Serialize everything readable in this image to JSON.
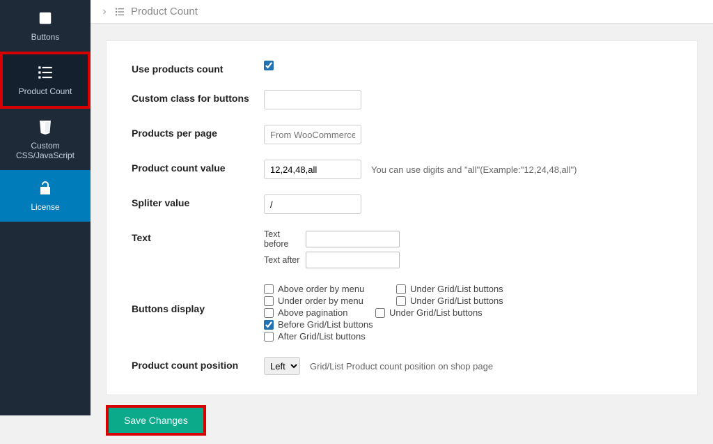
{
  "sidebar": {
    "items": [
      {
        "label": "Buttons",
        "label2": ""
      },
      {
        "label": "Product Count",
        "label2": ""
      },
      {
        "label": "Custom",
        "label2": "CSS/JavaScript"
      },
      {
        "label": "License",
        "label2": ""
      }
    ]
  },
  "breadcrumb": {
    "title": "Product Count"
  },
  "form": {
    "use_products_count_label": "Use products count",
    "custom_class_label": "Custom class for buttons",
    "custom_class_value": "",
    "products_per_page_label": "Products per page",
    "products_per_page_placeholder": "From WooCommerce",
    "product_count_value_label": "Product count value",
    "product_count_value_value": "12,24,48,all",
    "product_count_value_help": "You can use digits and \"all\"(Example:\"12,24,48,all\")",
    "spliter_value_label": "Spliter value",
    "spliter_value_value": "/",
    "text_label": "Text",
    "text_before_label": "Text before",
    "text_before_value": "",
    "text_after_label": "Text after",
    "text_after_value": "",
    "buttons_display_label": "Buttons display",
    "buttons_display_options": {
      "above_order": "Above order by menu",
      "under_order": "Under order by menu",
      "above_pagination": "Above pagination",
      "before_gridlist": "Before Grid/List buttons",
      "after_gridlist": "After Grid/List buttons",
      "under_gridlist1": "Under Grid/List buttons",
      "under_gridlist2": "Under Grid/List buttons",
      "under_gridlist3": "Under Grid/List buttons"
    },
    "position_label": "Product count position",
    "position_value": "Left",
    "position_help": "Grid/List Product count position on shop page"
  },
  "actions": {
    "save_label": "Save Changes"
  }
}
